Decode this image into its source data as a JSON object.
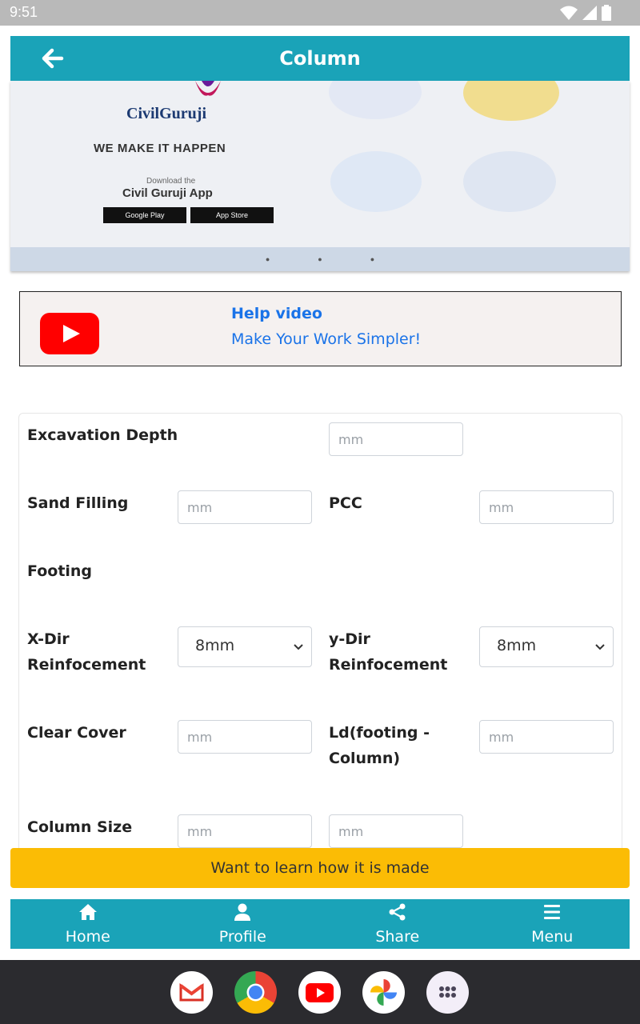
{
  "status_bar": {
    "time": "9:51"
  },
  "header": {
    "title": "Column"
  },
  "banner": {
    "brand": "CivilGuruji",
    "tagline": "WE MAKE IT HAPPEN",
    "download_text": "Download the",
    "app_name": "Civil Guruji App",
    "google_play": "Google Play",
    "app_store": "App Store"
  },
  "help": {
    "title": "Help video",
    "subtitle": "Make Your Work Simpler!"
  },
  "form": {
    "excavation_depth": {
      "label": "Excavation Depth",
      "placeholder": "mm"
    },
    "sand_filling": {
      "label": "Sand Filling",
      "placeholder": "mm"
    },
    "pcc": {
      "label": "PCC",
      "placeholder": "mm"
    },
    "footing": {
      "label": "Footing"
    },
    "x_dir": {
      "label_line1": "X-Dir",
      "label_line2": "Reinfocement",
      "value": "8mm"
    },
    "y_dir": {
      "label_line1": "y-Dir",
      "label_line2": "Reinfocement",
      "value": "8mm"
    },
    "clear_cover": {
      "label": "Clear Cover",
      "placeholder": "mm"
    },
    "ld": {
      "label_line1": "Ld(footing -",
      "label_line2": "Column)",
      "placeholder": "mm"
    },
    "column_size": {
      "label": "Column Size",
      "placeholder_a": "mm",
      "placeholder_b": "mm"
    }
  },
  "learn_button": "Want to learn how it is made",
  "bottom_nav": [
    {
      "label": "Home",
      "icon": "home-icon"
    },
    {
      "label": "Profile",
      "icon": "user-icon"
    },
    {
      "label": "Share",
      "icon": "share-icon"
    },
    {
      "label": "Menu",
      "icon": "menu-icon"
    }
  ],
  "dock_apps": [
    "gmail-icon",
    "chrome-icon",
    "youtube-icon",
    "photos-icon",
    "app-drawer-icon"
  ],
  "colors": {
    "primary": "#1aa3b8",
    "accent": "#fbbc05",
    "link": "#1a73e8"
  }
}
